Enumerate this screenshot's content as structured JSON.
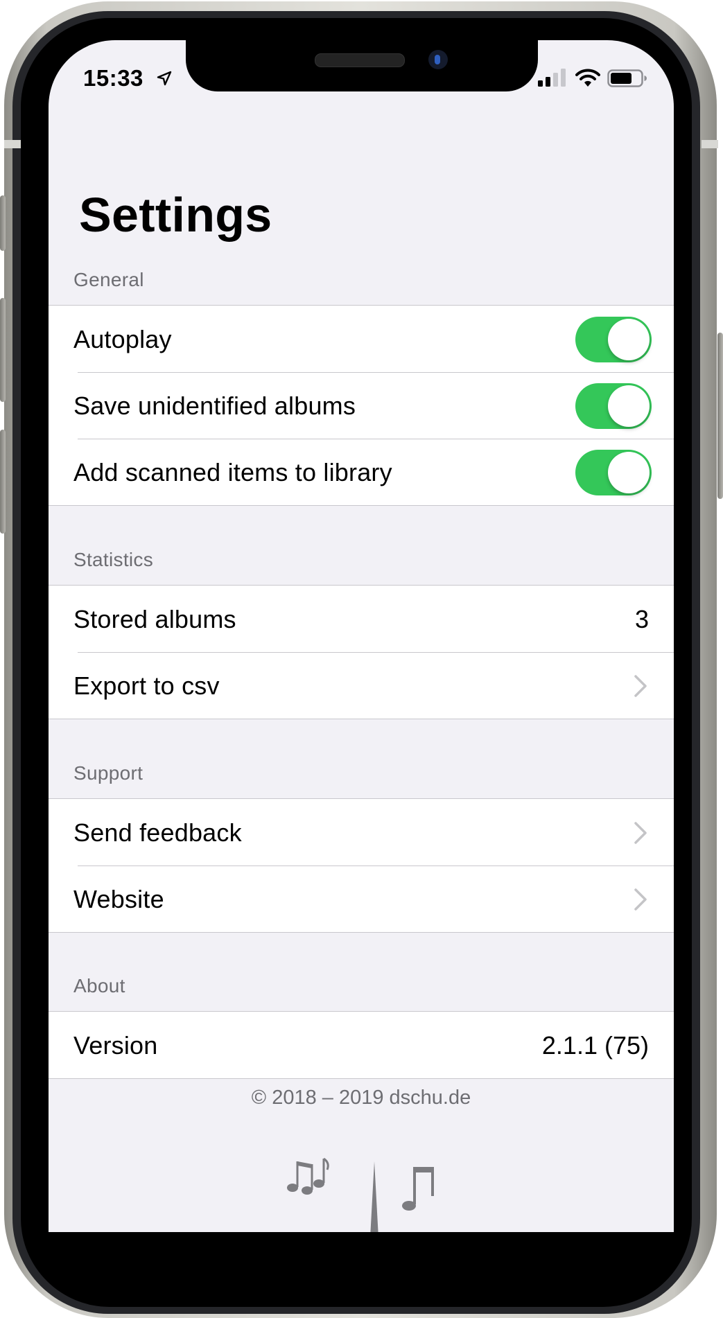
{
  "status_bar": {
    "time": "15:33",
    "location_icon": "location-arrow-icon",
    "signal_icon": "cellular-signal-icon",
    "wifi_icon": "wifi-icon",
    "battery_icon": "battery-icon"
  },
  "page": {
    "title": "Settings"
  },
  "sections": [
    {
      "header": "General",
      "rows": [
        {
          "label": "Autoplay",
          "toggle_on": true
        },
        {
          "label": "Save unidentified albums",
          "toggle_on": true
        },
        {
          "label": "Add scanned items to library",
          "toggle_on": true
        }
      ]
    },
    {
      "header": "Statistics",
      "rows": [
        {
          "label": "Stored albums",
          "value": "3"
        },
        {
          "label": "Export to csv",
          "accessory": "chevron-right-icon"
        }
      ]
    },
    {
      "header": "Support",
      "rows": [
        {
          "label": "Send feedback",
          "accessory": "chevron-right-icon"
        },
        {
          "label": "Website",
          "accessory": "chevron-right-icon"
        }
      ]
    },
    {
      "header": "About",
      "rows": [
        {
          "label": "Version",
          "value": "2.1.1 (75)"
        }
      ]
    }
  ],
  "footer": {
    "copyright": "© 2018 – 2019 dschu.de",
    "logo_icon": "music-notes-logo-icon"
  },
  "colors": {
    "toggle_on": "#34c759",
    "background": "#f2f1f6",
    "secondary_text": "#6d6d72",
    "separator": "#c8c7cc"
  }
}
